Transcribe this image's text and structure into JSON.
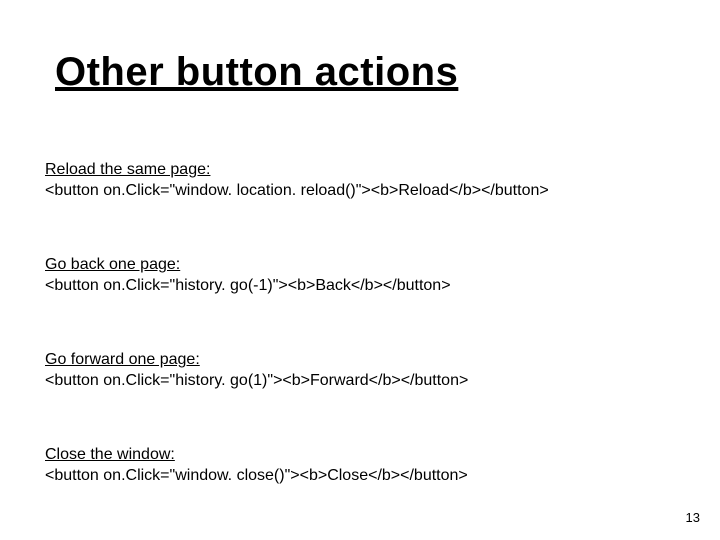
{
  "title": "Other button actions",
  "sections": [
    {
      "label": "Reload the same page:",
      "code": "<button on.Click=\"window. location. reload()\"><b>Reload</b></button>"
    },
    {
      "label": "Go back one page:",
      "code": "<button on.Click=\"history. go(-1)\"><b>Back</b></button>"
    },
    {
      "label": "Go forward one page:",
      "code": "<button on.Click=\"history. go(1)\"><b>Forward</b></button>"
    },
    {
      "label": "Close the window:",
      "code": "<button on.Click=\"window. close()\"><b>Close</b></button>"
    }
  ],
  "page_number": "13"
}
